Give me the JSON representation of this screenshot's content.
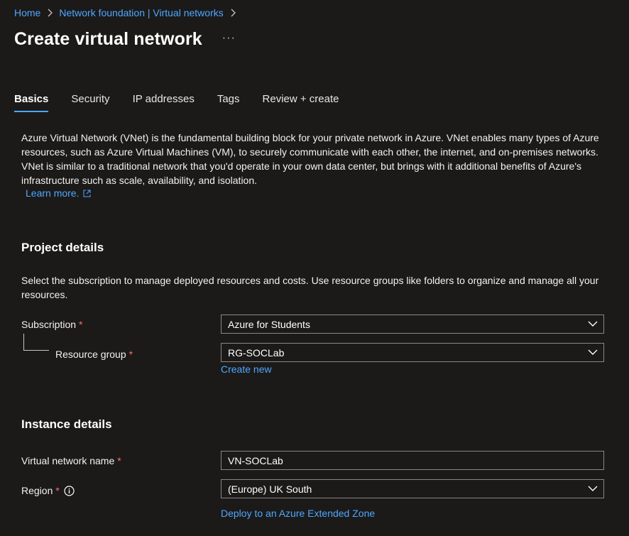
{
  "breadcrumb": {
    "home": "Home",
    "parent": "Network foundation | Virtual networks"
  },
  "title": "Create virtual network",
  "more": "···",
  "tabs": [
    {
      "label": "Basics",
      "active": true
    },
    {
      "label": "Security",
      "active": false
    },
    {
      "label": "IP addresses",
      "active": false
    },
    {
      "label": "Tags",
      "active": false
    },
    {
      "label": "Review + create",
      "active": false
    }
  ],
  "intro": {
    "text": "Azure Virtual Network (VNet) is the fundamental building block for your private network in Azure. VNet enables many types of Azure resources, such as Azure Virtual Machines (VM), to securely communicate with each other, the internet, and on-premises networks. VNet is similar to a traditional network that you'd operate in your own data center, but brings with it additional benefits of Azure's infrastructure such as scale, availability, and isolation.",
    "learn_more": "Learn more."
  },
  "project": {
    "heading": "Project details",
    "description": "Select the subscription to manage deployed resources and costs. Use resource groups like folders to organize and manage all your resources.",
    "subscription_label": "Subscription",
    "subscription_value": "Azure for Students",
    "resource_group_label": "Resource group",
    "resource_group_value": "RG-SOCLab",
    "create_new": "Create new"
  },
  "instance": {
    "heading": "Instance details",
    "vnet_name_label": "Virtual network name",
    "vnet_name_value": "VN-SOCLab",
    "region_label": "Region",
    "region_value": "(Europe) UK South",
    "extended_zone": "Deploy to an Azure Extended Zone"
  },
  "required_marker": "*",
  "colors": {
    "background": "#1b1a19",
    "link": "#4fa7ff",
    "required": "#ff6b6b",
    "border": "#8a8886"
  },
  "icons": [
    "chevron-right-icon",
    "external-link-icon",
    "chevron-down-icon",
    "info-icon"
  ]
}
